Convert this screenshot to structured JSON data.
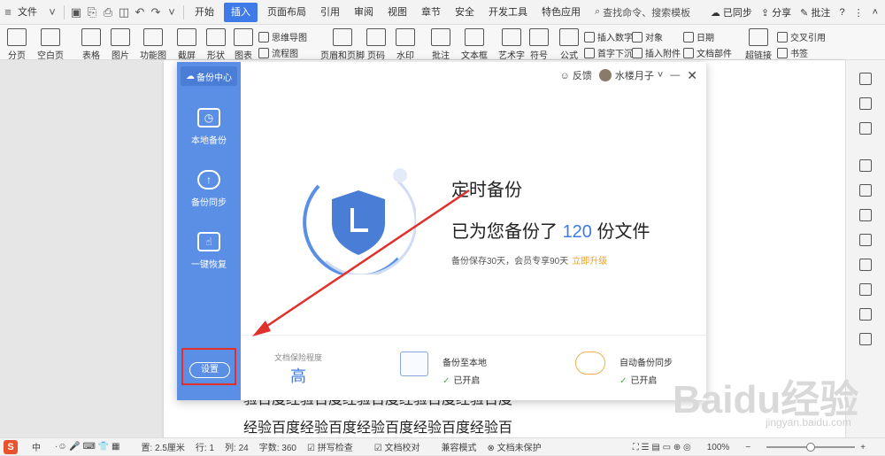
{
  "menubar": {
    "file": "文件",
    "tabs": [
      "开始",
      "插入",
      "页面布局",
      "引用",
      "审阅",
      "视图",
      "章节",
      "安全",
      "开发工具",
      "特色应用"
    ],
    "active_tab": "插入",
    "search": "查找命令、搜索模板",
    "synced": "已同步",
    "share": "分享",
    "comment": "批注"
  },
  "toolbar": {
    "page_break": "分页",
    "blank_page": "空白页",
    "table": "表格",
    "image": "图片",
    "function_chart": "功能图",
    "screenshot": "截屏",
    "shape": "形状",
    "chart": "图表",
    "mindmap": "思维导图",
    "flowchart": "流程图",
    "header_footer": "页眉和页脚",
    "page_number": "页码",
    "watermark": "水印",
    "comment": "批注",
    "textbox": "文本框",
    "wordart": "艺术字",
    "symbol": "符号",
    "formula": "公式",
    "insert_number": "插入数字",
    "object": "对象",
    "date": "日期",
    "drop_cap": "首字下沉",
    "insert_attachment": "插入附件",
    "doc_parts": "文档部件",
    "hyperlink": "超链接",
    "cross_ref": "交叉引用",
    "bookmark": "书签"
  },
  "dialog": {
    "brand": "备份中心",
    "nav": [
      "本地备份",
      "备份同步",
      "一键恢复"
    ],
    "settings": "设置",
    "feedback": "反馈",
    "user": "水楼月子",
    "title": "定时备份",
    "line2_prefix": "已为您备份了",
    "count": "120",
    "line2_suffix": "份文件",
    "line3": "备份保存30天，会员专享90天",
    "upgrade": "立即升级",
    "protection_label": "文档保险程度",
    "protection_value": "高",
    "local_title": "备份至本地",
    "local_status": "已开启",
    "sync_title": "自动备份同步",
    "sync_status": "已开启"
  },
  "document": {
    "line1": "验百度经验百度经验百度经验百度经验百度",
    "line2": "经验百度经验百度经验百度经验百度经验百"
  },
  "statusbar": {
    "ime": [
      "中"
    ],
    "margin": "置: 2.5厘米",
    "row": "行: 1",
    "col": "列: 24",
    "words": "字数: 360",
    "spell": "拼写检查",
    "proof": "文档校对",
    "compat": "兼容模式",
    "protect": "文档未保护",
    "zoom": "100%"
  },
  "watermark": {
    "main": "Baidu经验",
    "sub": "jingyan.baidu.com"
  },
  "colors": {
    "accent": "#3e7be8",
    "sidebar": "#5b8fe6",
    "arrow": "#e0302b"
  }
}
